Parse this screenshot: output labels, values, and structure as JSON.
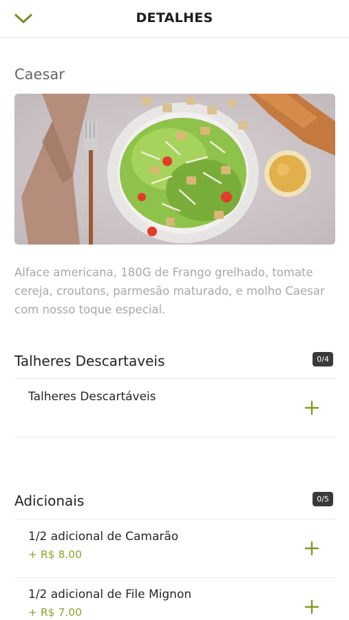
{
  "header": {
    "title": "DETALHES",
    "back_icon": "chevron-down-icon",
    "accent_color": "#6f8f1f"
  },
  "product": {
    "name": "Caesar",
    "image_alt": "Salada Caesar",
    "description": "Alface americana, 180G de Frango grelhado, tomate cereja, croutons, parmesão maturado, e molho Caesar com nosso toque especial."
  },
  "groups": [
    {
      "title": "Talheres Descartaveis",
      "badge": "0/4",
      "options": [
        {
          "label": "Talheres Descartáveis",
          "price": ""
        }
      ]
    },
    {
      "title": "Adicionais",
      "badge": "0/5",
      "options": [
        {
          "label": "1/2 adicional de Camarão",
          "price": "+ R$ 8.00"
        },
        {
          "label": "1/2 adicional de File Mignon",
          "price": "+ R$ 7.00"
        }
      ]
    }
  ]
}
